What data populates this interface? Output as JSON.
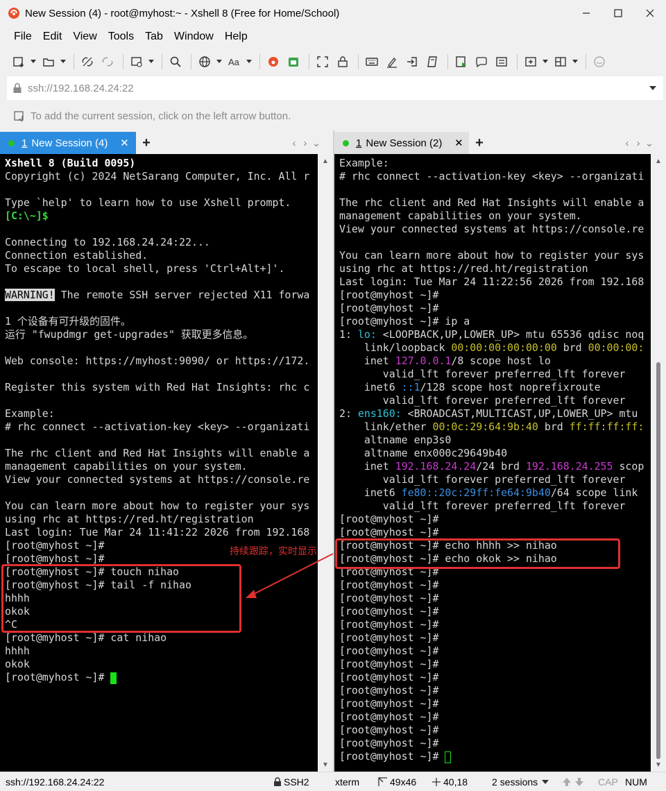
{
  "window": {
    "title": "New Session (4) - root@myhost:~ - Xshell 8 (Free for Home/School)",
    "minimize_label": "—",
    "maximize_label": "☐",
    "close_label": "✕"
  },
  "menu": [
    "File",
    "Edit",
    "View",
    "Tools",
    "Tab",
    "Window",
    "Help"
  ],
  "address": {
    "value": "ssh://192.168.24.24:22"
  },
  "hint": {
    "text": "To add the current session, click on the left arrow button."
  },
  "tabs": {
    "left": {
      "num": "1",
      "label": "New Session (4)",
      "close": "✕",
      "add": "+",
      "nav_prev": "‹",
      "nav_next": "›",
      "nav_menu": "⌄"
    },
    "right": {
      "num": "1",
      "label": "New Session (2)",
      "close": "✕",
      "add": "+",
      "nav_prev": "‹",
      "nav_next": "›",
      "nav_menu": "⌄"
    }
  },
  "left_terminal": [
    [
      {
        "t": "Xshell 8 (Build 0095)",
        "c": "bold"
      }
    ],
    [
      {
        "t": "Copyright (c) 2024 NetSarang Computer, Inc. All r"
      }
    ],
    [
      {
        "t": ""
      }
    ],
    [
      {
        "t": "Type `help' to learn how to use Xshell prompt."
      }
    ],
    [
      {
        "t": "[C:\\~]$",
        "c": "green"
      }
    ],
    [
      {
        "t": ""
      }
    ],
    [
      {
        "t": "Connecting to 192.168.24.24:22..."
      }
    ],
    [
      {
        "t": "Connection established."
      }
    ],
    [
      {
        "t": "To escape to local shell, press 'Ctrl+Alt+]'."
      }
    ],
    [
      {
        "t": ""
      }
    ],
    [
      {
        "t": "WARNING!",
        "c": "warn"
      },
      {
        "t": " The remote SSH server rejected X11 forwa"
      }
    ],
    [
      {
        "t": ""
      }
    ],
    [
      {
        "t": "1 个设备有可升级的固件。"
      }
    ],
    [
      {
        "t": "运行 \"fwupdmgr get-upgrades\" 获取更多信息。"
      }
    ],
    [
      {
        "t": ""
      }
    ],
    [
      {
        "t": "Web console: https://myhost:9090/ or https://172."
      }
    ],
    [
      {
        "t": ""
      }
    ],
    [
      {
        "t": "Register this system with Red Hat Insights: rhc c"
      }
    ],
    [
      {
        "t": ""
      }
    ],
    [
      {
        "t": "Example:"
      }
    ],
    [
      {
        "t": "# rhc connect --activation-key <key> --organizati"
      }
    ],
    [
      {
        "t": ""
      }
    ],
    [
      {
        "t": "The rhc client and Red Hat Insights will enable a"
      }
    ],
    [
      {
        "t": "management capabilities on your system."
      }
    ],
    [
      {
        "t": "View your connected systems at https://console.re"
      }
    ],
    [
      {
        "t": ""
      }
    ],
    [
      {
        "t": "You can learn more about how to register your sys"
      }
    ],
    [
      {
        "t": "using rhc at https://red.ht/registration"
      }
    ],
    [
      {
        "t": "Last login: Tue Mar 24 11:41:22 2026 from 192.168"
      }
    ],
    [
      {
        "t": "[root@myhost ~]#"
      }
    ],
    [
      {
        "t": "[root@myhost ~]#"
      }
    ],
    [
      {
        "t": "[root@myhost ~]# touch nihao"
      }
    ],
    [
      {
        "t": "[root@myhost ~]# tail -f nihao"
      }
    ],
    [
      {
        "t": "hhhh"
      }
    ],
    [
      {
        "t": "okok"
      }
    ],
    [
      {
        "t": "^C"
      }
    ],
    [
      {
        "t": "[root@myhost ~]# cat nihao"
      }
    ],
    [
      {
        "t": "hhhh"
      }
    ],
    [
      {
        "t": "okok"
      }
    ],
    [
      {
        "t": "[root@myhost ~]# "
      }
    ]
  ],
  "right_terminal": [
    [
      {
        "t": "Example:"
      }
    ],
    [
      {
        "t": "# rhc connect --activation-key <key> --organizati"
      }
    ],
    [
      {
        "t": ""
      }
    ],
    [
      {
        "t": "The rhc client and Red Hat Insights will enable a"
      }
    ],
    [
      {
        "t": "management capabilities on your system."
      }
    ],
    [
      {
        "t": "View your connected systems at https://console.re"
      }
    ],
    [
      {
        "t": ""
      }
    ],
    [
      {
        "t": "You can learn more about how to register your sys"
      }
    ],
    [
      {
        "t": "using rhc at https://red.ht/registration"
      }
    ],
    [
      {
        "t": "Last login: Tue Mar 24 11:22:56 2026 from 192.168"
      }
    ],
    [
      {
        "t": "[root@myhost ~]#"
      }
    ],
    [
      {
        "t": "[root@myhost ~]#"
      }
    ],
    [
      {
        "t": "[root@myhost ~]# ip a"
      }
    ],
    [
      {
        "t": "1: "
      },
      {
        "t": "lo:",
        "c": "cyan"
      },
      {
        "t": " <LOOPBACK,UP,LOWER_UP> mtu 65536 qdisc noq"
      }
    ],
    [
      {
        "t": "    link/loopback "
      },
      {
        "t": "00:00:00:00:00:00",
        "c": "yellow"
      },
      {
        "t": " brd "
      },
      {
        "t": "00:00:00:",
        "c": "yellow"
      }
    ],
    [
      {
        "t": "    inet "
      },
      {
        "t": "127.0.0.1",
        "c": "magenta"
      },
      {
        "t": "/8 scope host lo"
      }
    ],
    [
      {
        "t": "       valid_lft forever preferred_lft forever"
      }
    ],
    [
      {
        "t": "    inet6 "
      },
      {
        "t": "::1",
        "c": "blue"
      },
      {
        "t": "/128 scope host noprefixroute"
      }
    ],
    [
      {
        "t": "       valid_lft forever preferred_lft forever"
      }
    ],
    [
      {
        "t": "2: "
      },
      {
        "t": "ens160:",
        "c": "cyan"
      },
      {
        "t": " <BROADCAST,MULTICAST,UP,LOWER_UP> mtu"
      }
    ],
    [
      {
        "t": "    link/ether "
      },
      {
        "t": "00:0c:29:64:9b:40",
        "c": "yellow"
      },
      {
        "t": " brd "
      },
      {
        "t": "ff:ff:ff:ff:",
        "c": "yellow"
      }
    ],
    [
      {
        "t": "    altname enp3s0"
      }
    ],
    [
      {
        "t": "    altname enx000c29649b40"
      }
    ],
    [
      {
        "t": "    inet "
      },
      {
        "t": "192.168.24.24",
        "c": "magenta"
      },
      {
        "t": "/24 brd "
      },
      {
        "t": "192.168.24.255",
        "c": "magenta"
      },
      {
        "t": " scop"
      }
    ],
    [
      {
        "t": "       valid_lft forever preferred_lft forever"
      }
    ],
    [
      {
        "t": "    inet6 "
      },
      {
        "t": "fe80::20c:29ff:fe64:9b40",
        "c": "blue"
      },
      {
        "t": "/64 scope link"
      }
    ],
    [
      {
        "t": "       valid_lft forever preferred_lft forever"
      }
    ],
    [
      {
        "t": "[root@myhost ~]#"
      }
    ],
    [
      {
        "t": "[root@myhost ~]#"
      }
    ],
    [
      {
        "t": "[root@myhost ~]# echo hhhh >> nihao"
      }
    ],
    [
      {
        "t": "[root@myhost ~]# echo okok >> nihao"
      }
    ],
    [
      {
        "t": "[root@myhost ~]#"
      }
    ],
    [
      {
        "t": "[root@myhost ~]#"
      }
    ],
    [
      {
        "t": "[root@myhost ~]#"
      }
    ],
    [
      {
        "t": "[root@myhost ~]#"
      }
    ],
    [
      {
        "t": "[root@myhost ~]#"
      }
    ],
    [
      {
        "t": "[root@myhost ~]#"
      }
    ],
    [
      {
        "t": "[root@myhost ~]#"
      }
    ],
    [
      {
        "t": "[root@myhost ~]#"
      }
    ],
    [
      {
        "t": "[root@myhost ~]#"
      }
    ],
    [
      {
        "t": "[root@myhost ~]#"
      }
    ],
    [
      {
        "t": "[root@myhost ~]#"
      }
    ],
    [
      {
        "t": "[root@myhost ~]#"
      }
    ],
    [
      {
        "t": "[root@myhost ~]#"
      }
    ],
    [
      {
        "t": "[root@myhost ~]#"
      }
    ],
    [
      {
        "t": "[root@myhost ~]# "
      }
    ]
  ],
  "annotation": {
    "label": "持续跟踪，实时显示"
  },
  "status": {
    "address": "ssh://192.168.24.24:22",
    "protocol": "SSH2",
    "term": "xterm",
    "size": "49x46",
    "cursor": "40,18",
    "sessions": "2 sessions",
    "cap": "CAP",
    "num": "NUM"
  },
  "colors": {
    "accent_tab": "#2c8de0",
    "terminal_bg": "#000000",
    "prompt_green": "#3bd43b",
    "annotation_red": "#e03030"
  }
}
